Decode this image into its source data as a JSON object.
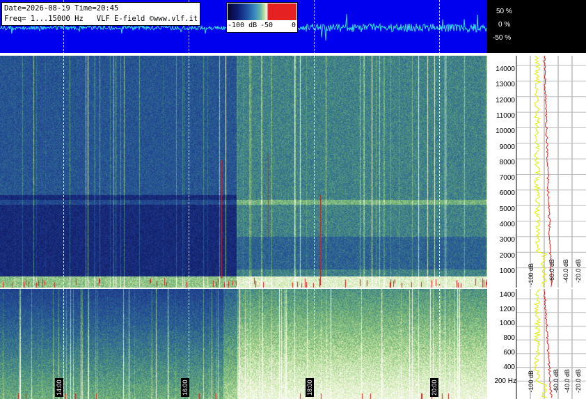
{
  "info": {
    "line1": "Date=2026-08-19 Time=20:45",
    "line2": "Freq= 1...15000 Hz   VLF E-field ©www.vlf.it"
  },
  "db_scale": {
    "labels": [
      "-100 dB",
      "-50",
      "0"
    ]
  },
  "waveform_scale": [
    "50 %",
    "0 %",
    "-50 %"
  ],
  "freq_upper_labels": [
    "14000",
    "13000",
    "12000",
    "11000",
    "10000",
    "9000",
    "8000",
    "7000",
    "6000",
    "5000",
    "4000",
    "3000",
    "2000",
    "1000"
  ],
  "freq_lower_labels": [
    "1400",
    "1200",
    "1000",
    "800",
    "600",
    "400",
    "200 Hz"
  ],
  "time_labels": [
    "14:00",
    "16:00",
    "18:00",
    "20:00"
  ],
  "bp_labels_upper": [
    "-100 dB",
    "-60.0 dB",
    "-40.0 dB",
    "-20.0 dB"
  ],
  "bp_labels_lower": [
    "-100 dB",
    "-60.0 dB",
    "-40.0 dB",
    "-20.0 dB"
  ],
  "colors": {
    "waveform_bg": "#0000ee",
    "trace": "#35e0e0",
    "green_curve": "#e0f020",
    "red_curve": "#e02020"
  }
}
